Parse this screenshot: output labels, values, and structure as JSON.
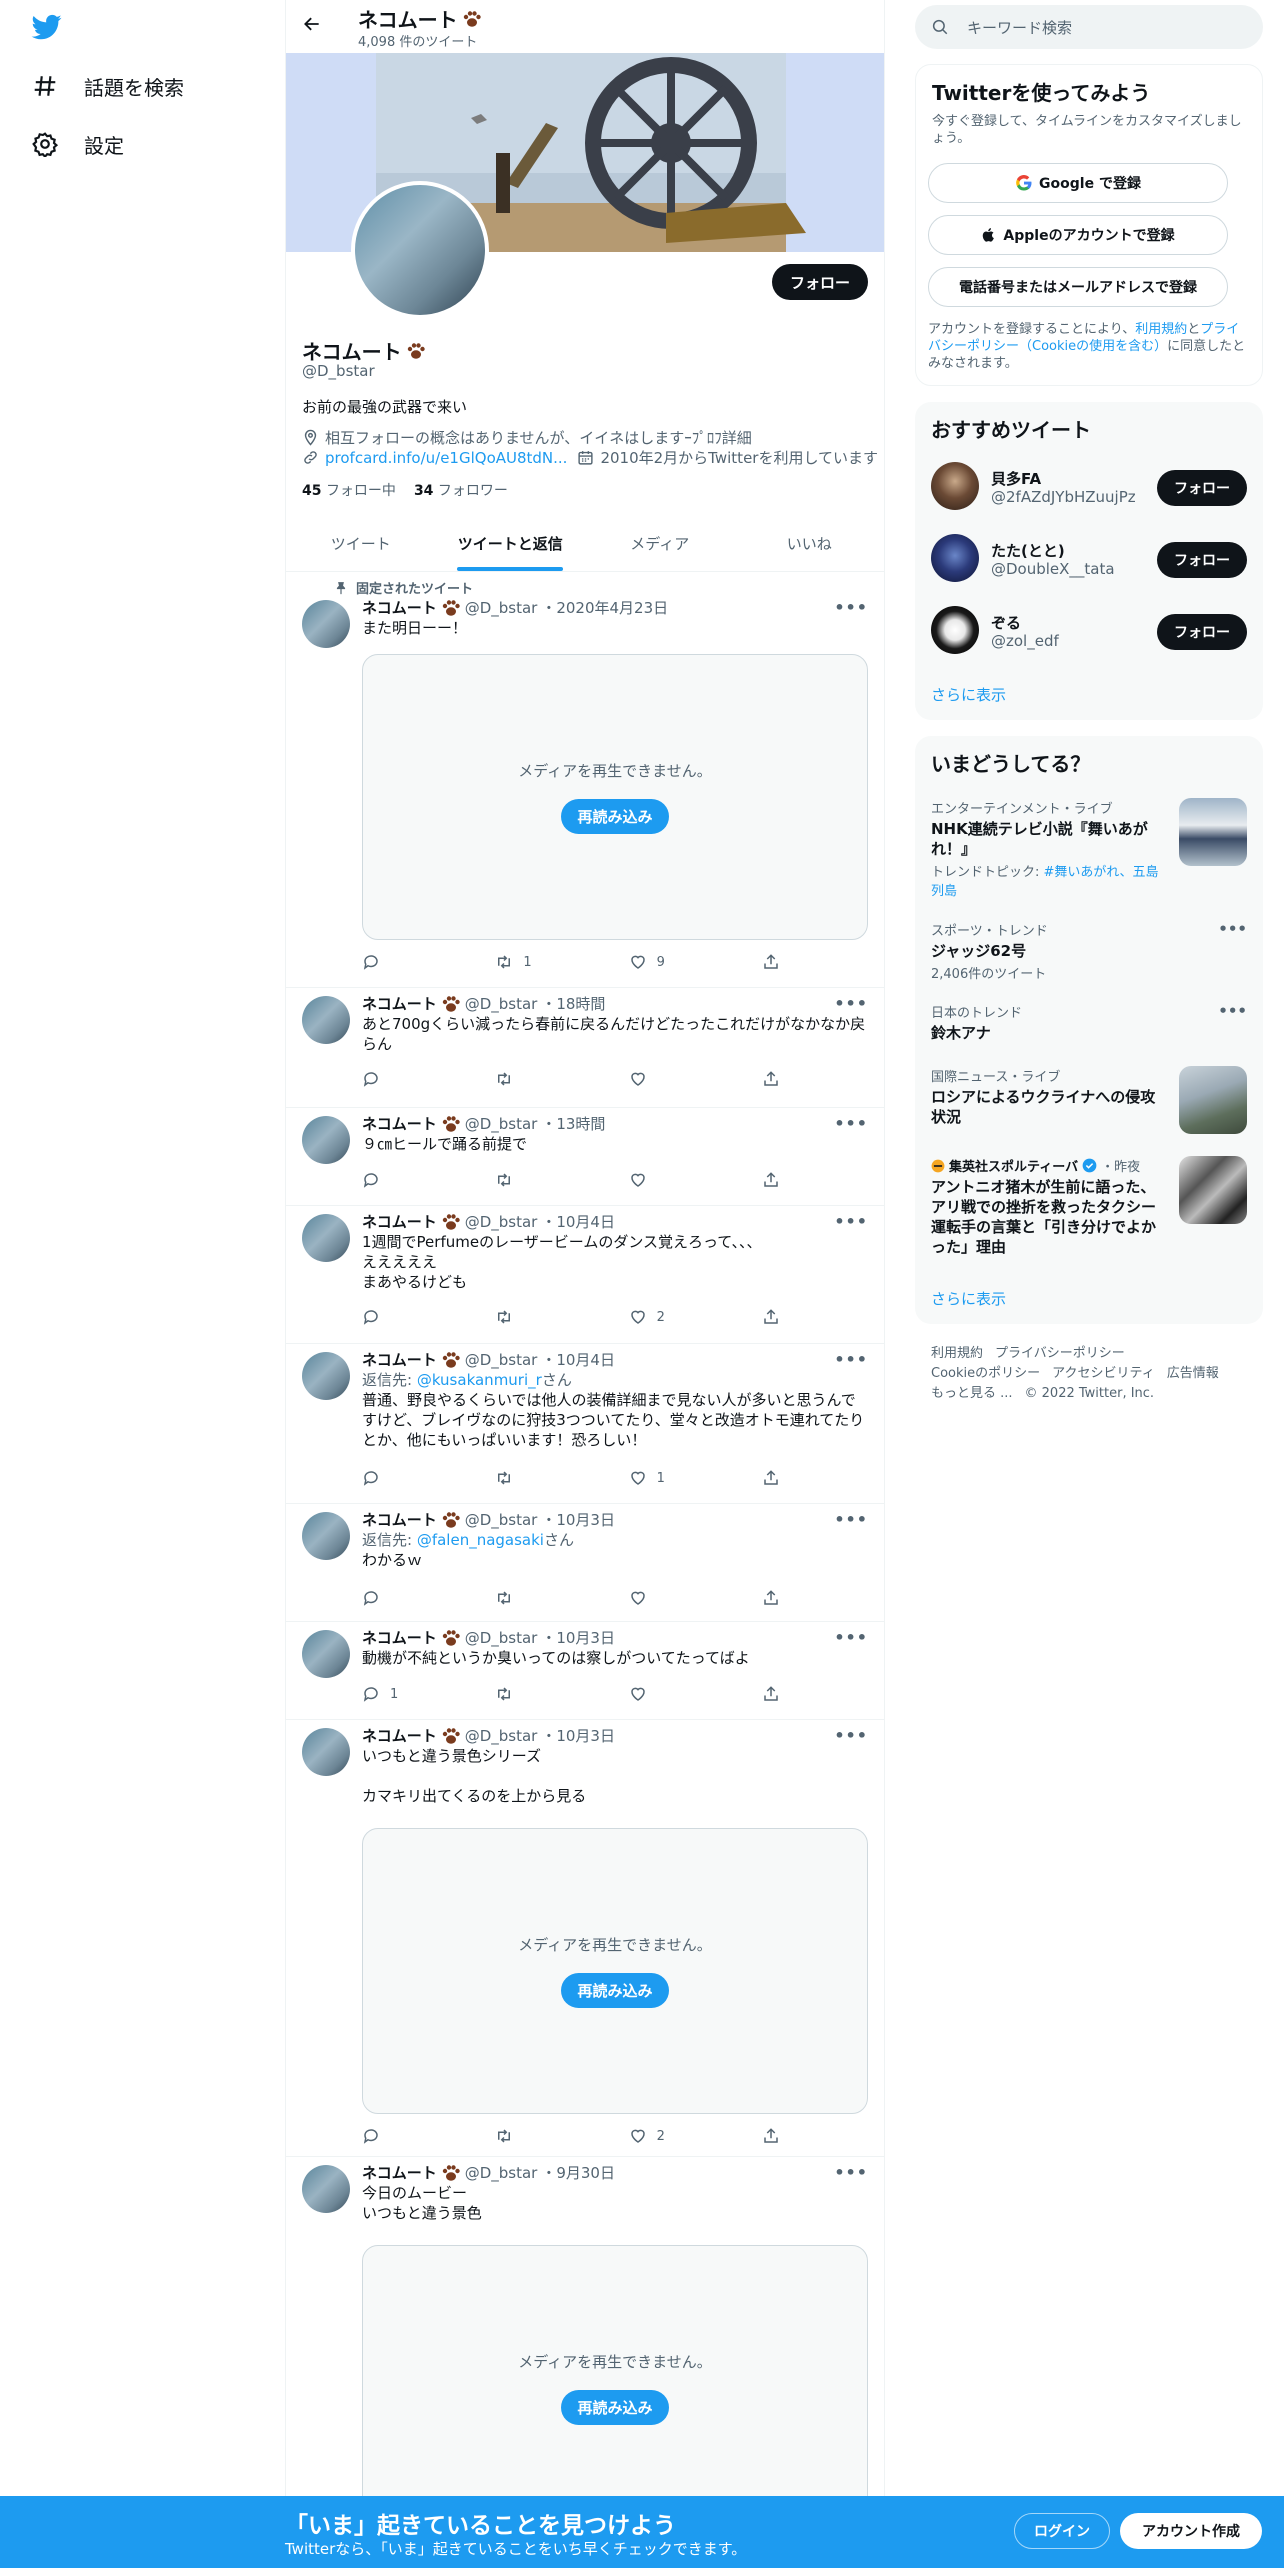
{
  "nav": {
    "explore_label": "話題を検索",
    "settings_label": "設定"
  },
  "profile": {
    "name": "ネコムート",
    "tweet_count": "4,098 件のツイート",
    "handle": "@D_bstar",
    "follow_label": "フォロー",
    "bio": "お前の最強の武器で来い",
    "location": "相互フォローの概念はありませんが、イイネはしますｰﾌﾟﾛﾌ詳細",
    "url": "profcard.info/u/e1GlQoAU8tdN...",
    "joined": "2010年2月からTwitterを利用しています",
    "following_count": "45",
    "following_label": "フォロー中",
    "followers_count": "34",
    "followers_label": "フォロワー"
  },
  "tabs": [
    "ツイート",
    "ツイートと返信",
    "メディア",
    "いいね"
  ],
  "pinned_label": "固定されたツイート",
  "media_unavailable": "メディアを再生できません。",
  "reload_label": "再読み込み",
  "tweets": [
    {
      "name": "ネコムート",
      "handle": "@D_bstar",
      "time": "・2020年4月23日",
      "text": "また明日ーー！",
      "retweets": "1",
      "likes": "9"
    },
    {
      "name": "ネコムート",
      "handle": "@D_bstar",
      "time": "・18時間",
      "text": "あと700gくらい減ったら春前に戻るんだけどたったこれだけがなかなか戻らん"
    },
    {
      "name": "ネコムート",
      "handle": "@D_bstar",
      "time": "・13時間",
      "text": "９㎝ヒールで踊る前提で"
    },
    {
      "name": "ネコムート",
      "handle": "@D_bstar",
      "time": "・10月4日",
      "text_lines": [
        "1週間でPerfumeのレーザービームのダンス覚えろって、、、",
        "えええええ",
        "まあやるけども"
      ],
      "likes": "2"
    },
    {
      "name": "ネコムート",
      "handle": "@D_bstar",
      "time": "・10月4日",
      "reply_prefix": "返信先: ",
      "reply_to": "@kusakanmuri_r",
      "reply_suffix": "さん",
      "text": "普通、野良やるくらいでは他人の装備詳細まで見ない人が多いと思うんですけど、ブレイヴなのに狩技3つついてたり、堂々と改造オトモ連れてたりとか、他にもいっぱいいます！恐ろしい！",
      "likes": "1"
    },
    {
      "name": "ネコムート",
      "handle": "@D_bstar",
      "time": "・10月3日",
      "reply_prefix": "返信先: ",
      "reply_to": "@falen_nagasaki",
      "reply_suffix": "さん",
      "text": "わかるｗ"
    },
    {
      "name": "ネコムート",
      "handle": "@D_bstar",
      "time": "・10月3日",
      "text": "動機が不純というか臭いってのは察しがついてたってばよ",
      "replies": "1"
    },
    {
      "name": "ネコムート",
      "handle": "@D_bstar",
      "time": "・10月3日",
      "text_lines": [
        "いつもと違う景色シリーズ",
        "",
        "カマキリ出てくるのを上から見る"
      ],
      "likes": "2"
    },
    {
      "name": "ネコムート",
      "handle": "@D_bstar",
      "time": "・9月30日",
      "text_lines": [
        "今日のムービー",
        "いつもと違う景色"
      ]
    }
  ],
  "search": {
    "placeholder": "キーワード検索"
  },
  "signup": {
    "title": "Twitterを使ってみよう",
    "desc": "今すぐ登録して、タイムラインをカスタマイズしましょう。",
    "google": "Google で登録",
    "apple": "Appleのアカウントで登録",
    "phone": "電話番号またはメールアドレスで登録",
    "terms_1": "アカウントを登録することにより、",
    "terms_link1": "利用規約",
    "terms_2": "と",
    "terms_link2": "プライバシーポリシー（Cookieの使用を含む）",
    "terms_3": "に同意したとみなされます。"
  },
  "recommend": {
    "title": "おすすめツイート",
    "users": [
      {
        "name": "貝多FA",
        "handle": "@2fAZdJYbHZuujPz",
        "follow": "フォロー"
      },
      {
        "name": "たた(とと)",
        "handle": "@DoubleX__tata",
        "follow": "フォロー"
      },
      {
        "name": "ぞる",
        "handle": "@zol_edf",
        "follow": "フォロー"
      }
    ],
    "show_more": "さらに表示"
  },
  "trends": {
    "title": "いまどうしてる？",
    "items": [
      {
        "category": "エンターテインメント・ライブ",
        "title": "NHK連続テレビ小説『舞いあがれ！』",
        "sub_prefix": "トレンドトピック: ",
        "sub_links": "#舞いあがれ、五島列島"
      },
      {
        "category": "スポーツ・トレンド",
        "title": "ジャッジ62号",
        "sub": "2,406件のツイート"
      },
      {
        "category": "日本のトレンド",
        "title": "鈴木アナ"
      },
      {
        "category": "国際ニュース・ライブ",
        "title": "ロシアによるウクライナへの侵攻状況"
      },
      {
        "source": "集英社スポルティーバ",
        "time": "・昨夜",
        "title": "アントニオ猪木が生前に語った、アリ戦での挫折を救ったタクシー運転手の言葉と「引き分けでよかった」理由"
      }
    ],
    "show_more": "さらに表示"
  },
  "footer": {
    "line1": [
      "利用規約",
      "プライバシーポリシー"
    ],
    "line2": [
      "Cookieのポリシー",
      "アクセシビリティ",
      "広告情報"
    ],
    "more": "もっと見る ...",
    "copyright": "© 2022 Twitter, Inc."
  },
  "bottom_bar": {
    "title": "「いま」起きていることを見つけよう",
    "sub": "Twitterなら、「いま」起きていることをいち早くチェックできます。",
    "login": "ログイン",
    "signup": "アカウント作成"
  }
}
